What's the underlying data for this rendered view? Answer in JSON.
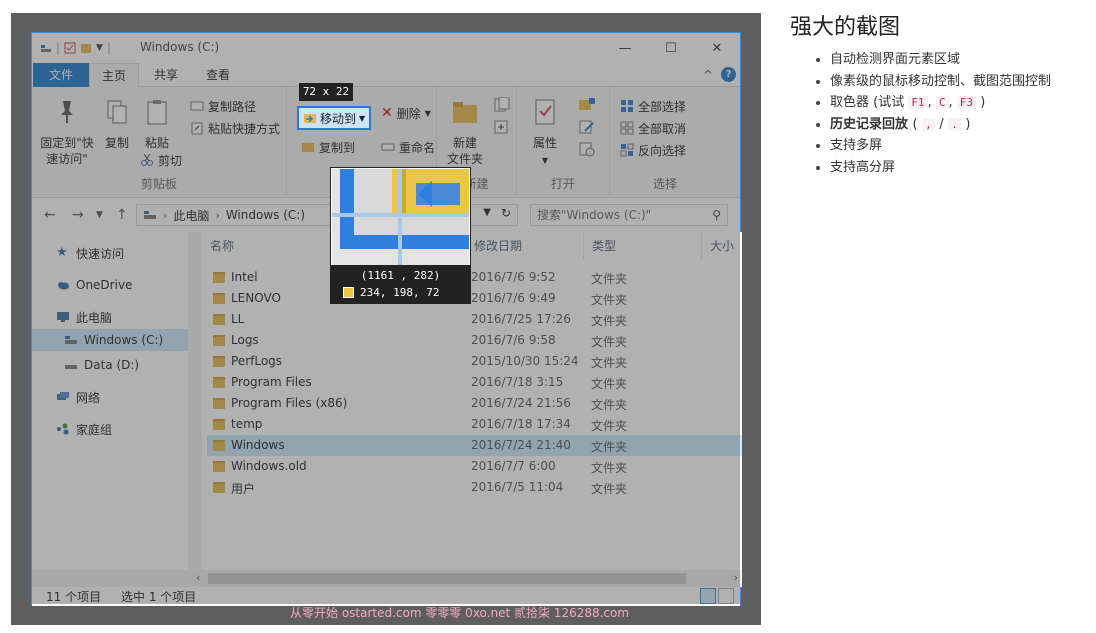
{
  "window": {
    "title": "Windows (C:)",
    "tabs": {
      "file": "文件",
      "home": "主页",
      "share": "共享",
      "view": "查看"
    }
  },
  "ribbon": {
    "pin": "固定到\"快速访问\"",
    "copy": "复制",
    "paste": "粘贴",
    "copy_path": "复制路径",
    "paste_shortcut": "粘贴快捷方式",
    "cut": "剪切",
    "clipboard_group": "剪贴板",
    "move_to": "移动到",
    "delete": "删除",
    "copy_to": "复制到",
    "rename": "重命名",
    "new_folder": "新建\n文件夹",
    "new_group": "新建",
    "properties": "属性",
    "open_group": "打开",
    "select_all": "全部选择",
    "select_none": "全部取消",
    "invert_selection": "反向选择",
    "select_group": "选择"
  },
  "capture": {
    "size_badge": "72 x 22",
    "coord": "(1161 , 282)",
    "rgb": "234, 198,  72",
    "pixel_color": "#eac648"
  },
  "address": {
    "root": "此电脑",
    "current": "Windows (C:)",
    "search_placeholder": "搜索\"Windows (C:)\""
  },
  "nav": {
    "quick_access": "快速访问",
    "onedrive": "OneDrive",
    "this_pc": "此电脑",
    "c_drive": "Windows (C:)",
    "d_drive": "Data (D:)",
    "network": "网络",
    "homegroup": "家庭组"
  },
  "columns": {
    "name": "名称",
    "date": "修改日期",
    "type": "类型",
    "size": "大小"
  },
  "files": [
    {
      "name": "Intel",
      "date": "2016/7/6 9:52",
      "type": "文件夹"
    },
    {
      "name": "LENOVO",
      "date": "2016/7/6 9:49",
      "type": "文件夹"
    },
    {
      "name": "LL",
      "date": "2016/7/25 17:26",
      "type": "文件夹"
    },
    {
      "name": "Logs",
      "date": "2016/7/6 9:58",
      "type": "文件夹"
    },
    {
      "name": "PerfLogs",
      "date": "2015/10/30 15:24",
      "type": "文件夹"
    },
    {
      "name": "Program Files",
      "date": "2016/7/18 3:15",
      "type": "文件夹"
    },
    {
      "name": "Program Files (x86)",
      "date": "2016/7/24 21:56",
      "type": "文件夹"
    },
    {
      "name": "temp",
      "date": "2016/7/18 17:34",
      "type": "文件夹"
    },
    {
      "name": "Windows",
      "date": "2016/7/24 21:40",
      "type": "文件夹"
    },
    {
      "name": "Windows.old",
      "date": "2016/7/7 6:00",
      "type": "文件夹"
    },
    {
      "name": "用户",
      "date": "2016/7/5 11:04",
      "type": "文件夹"
    }
  ],
  "status": {
    "count": "11 个项目",
    "selected": "选中 1 个项目"
  },
  "watermark": "从零开始 ostarted.com 零零零 0xo.net 贰拾柒 126288.com",
  "desc": {
    "title": "强大的截图",
    "items": {
      "auto_detect": "自动检测界面元素区域",
      "pixel_control": "像素级的鼠标移动控制、截图范围控制",
      "picker_prefix": "取色器 (试试",
      "picker_sep1": ",",
      "picker_sep2": ",",
      "picker_suffix": ")",
      "key_f1": "F1",
      "key_c": "C",
      "key_f3": "F3",
      "history_prefix": "历史记录回放",
      "history_open": "(",
      "history_sep": "/",
      "history_close": ")",
      "key_comma": ",",
      "key_dot": ".",
      "multi_screen": "支持多屏",
      "hidpi": "支持高分屏"
    }
  }
}
